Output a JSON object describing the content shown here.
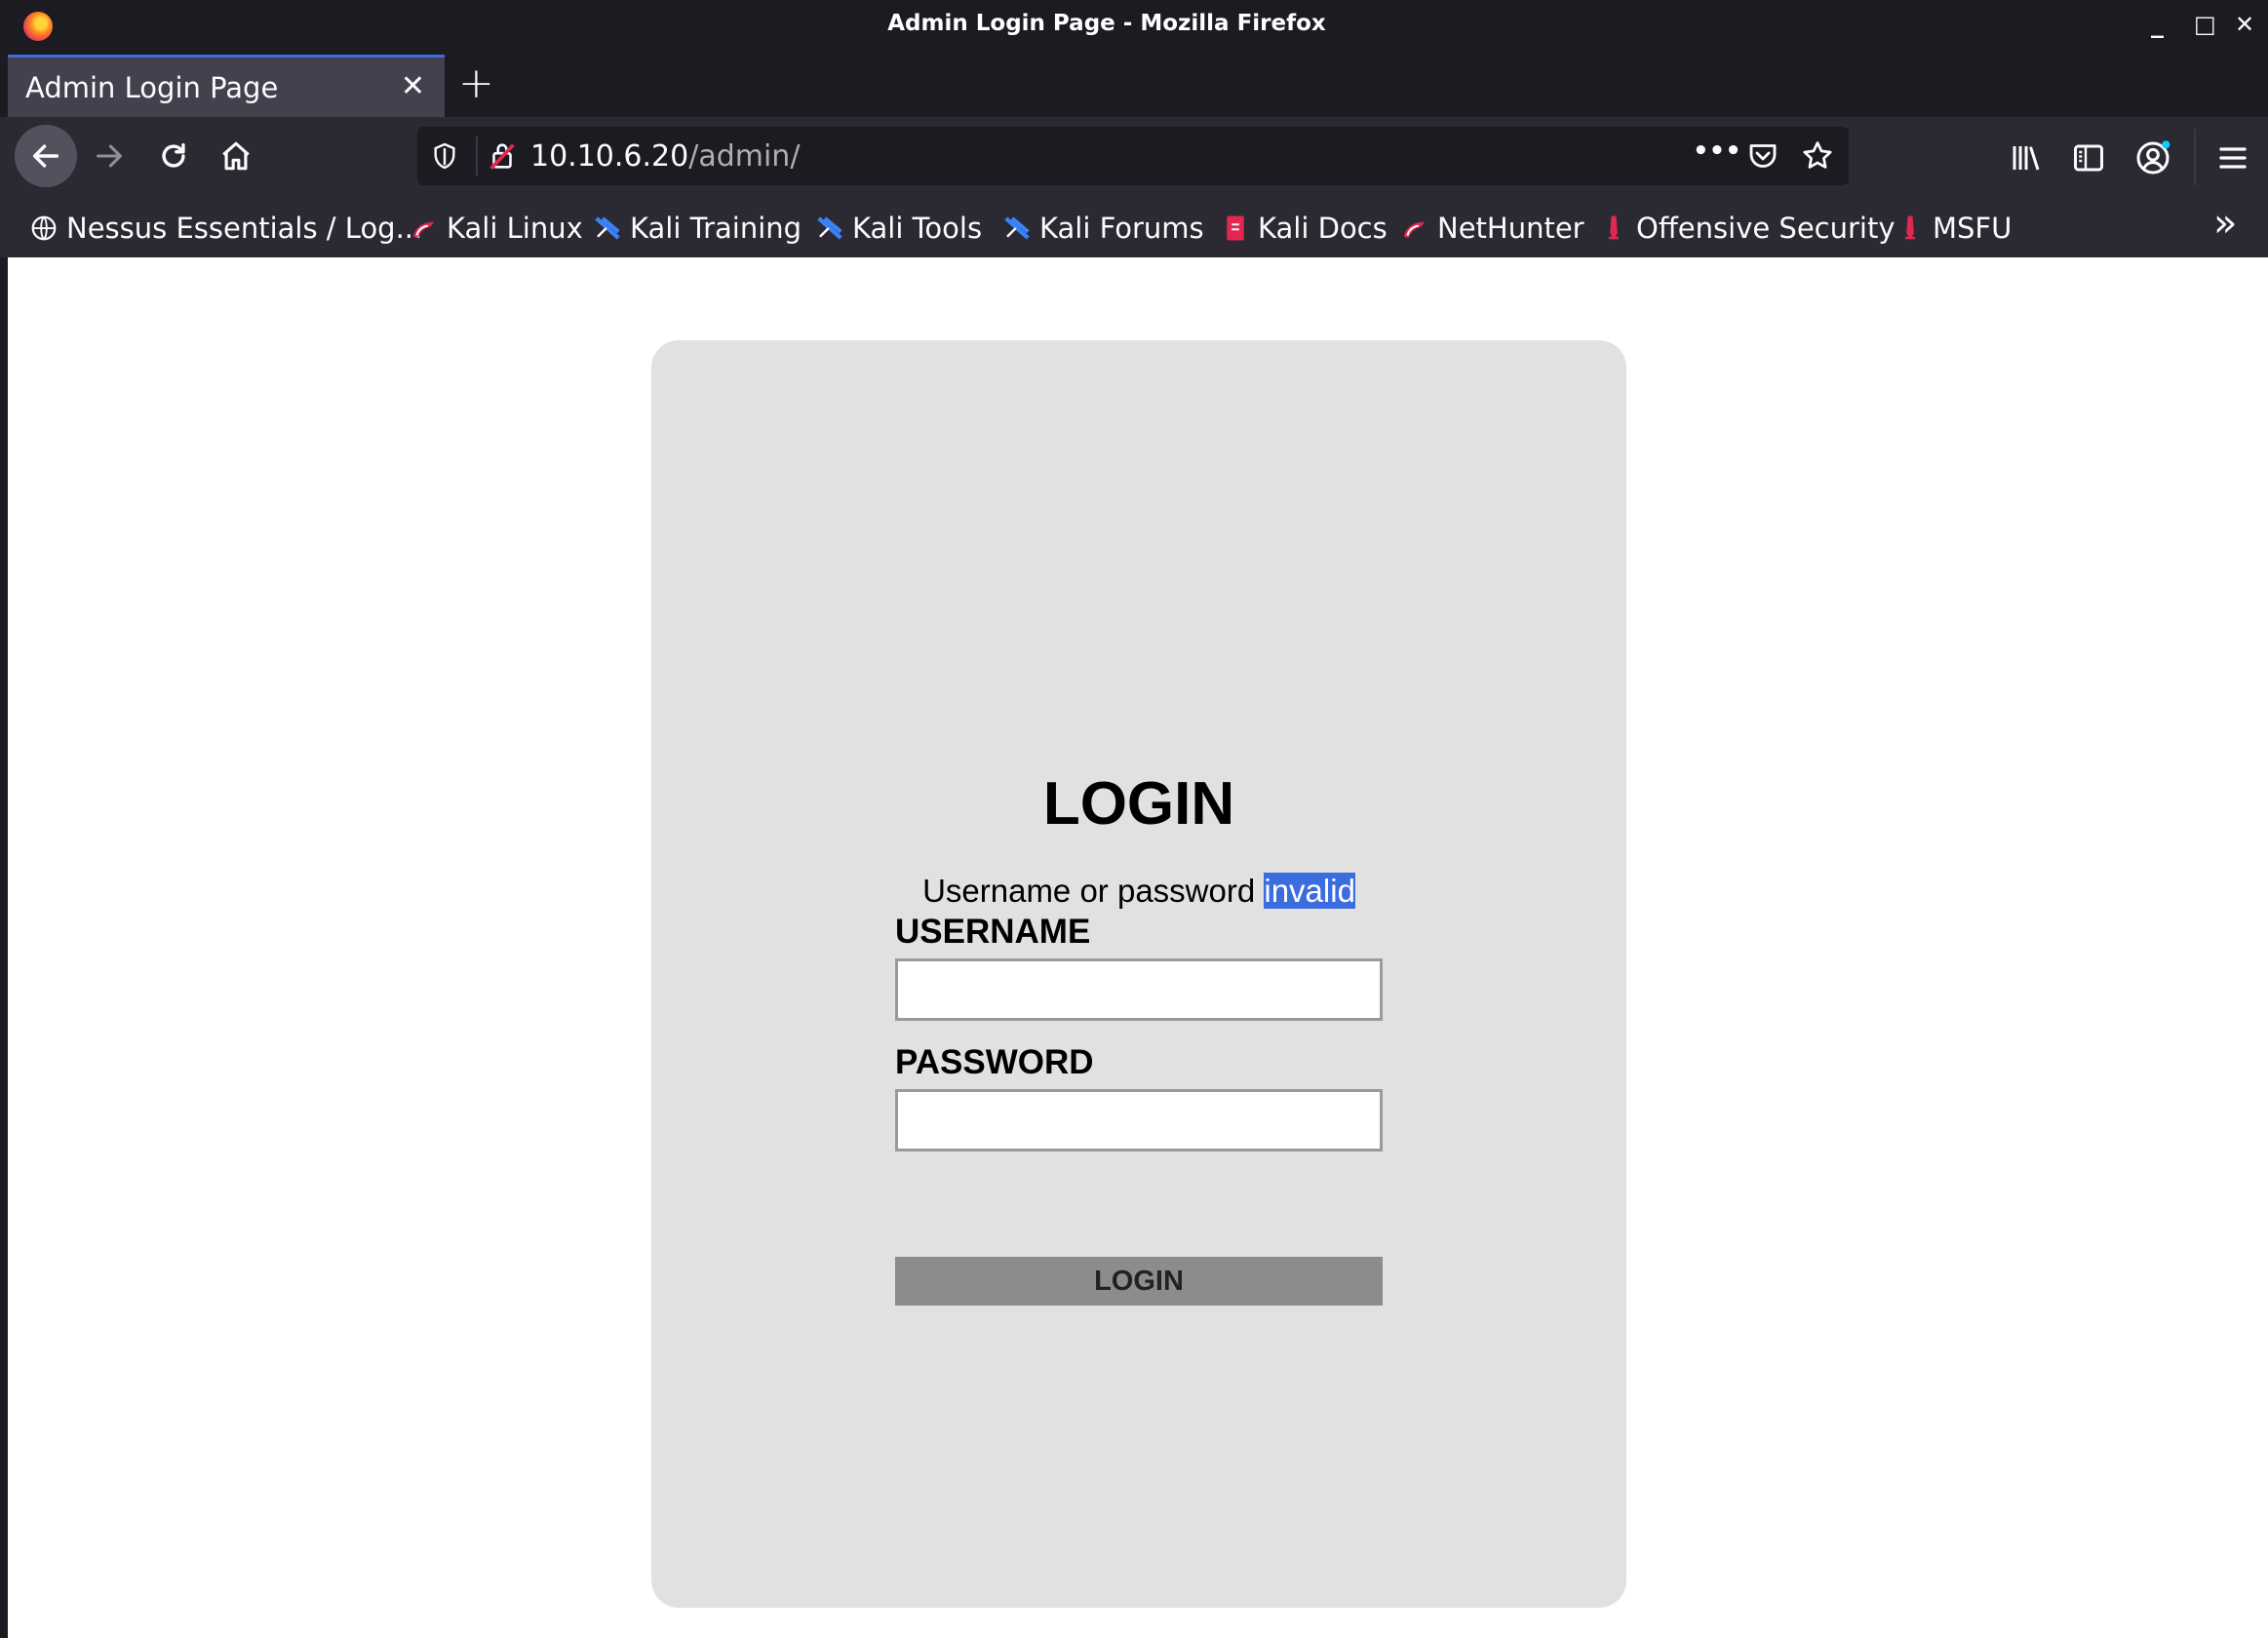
{
  "window": {
    "title": "Admin Login Page - Mozilla Firefox",
    "controls": {
      "minimize": "_",
      "maximize": "□",
      "close": "✕"
    }
  },
  "tabs": [
    {
      "label": "Admin Login Page",
      "active": true
    }
  ],
  "new_tab_label": "+",
  "urlbar": {
    "host": "10.10.6.20",
    "path": "/admin/",
    "more_label": "•••"
  },
  "bookmarks": [
    {
      "label": "Nessus Essentials / Log...",
      "icon": "globe-icon"
    },
    {
      "label": "Kali Linux",
      "icon": "kali-dragon-icon"
    },
    {
      "label": "Kali Training",
      "icon": "kali-training-icon"
    },
    {
      "label": "Kali Tools",
      "icon": "kali-tools-icon"
    },
    {
      "label": "Kali Forums",
      "icon": "kali-forums-icon"
    },
    {
      "label": "Kali Docs",
      "icon": "kali-docs-icon"
    },
    {
      "label": "NetHunter",
      "icon": "nethunter-icon"
    },
    {
      "label": "Offensive Security",
      "icon": "offsec-icon"
    },
    {
      "label": "MSFU",
      "icon": "msfu-icon"
    }
  ],
  "bookmarks_overflow": "»",
  "page": {
    "heading": "LOGIN",
    "error_prefix": "Username or password ",
    "error_selected": "invalid",
    "username_label": "USERNAME",
    "username_value": "",
    "password_label": "PASSWORD",
    "password_value": "",
    "login_button": "LOGIN"
  },
  "colors": {
    "accent": "#3b6ce0",
    "chrome_dark": "#1c1b22",
    "toolbar": "#2b2a33",
    "card": "#e1e1e1",
    "button": "#8c8c8c"
  }
}
